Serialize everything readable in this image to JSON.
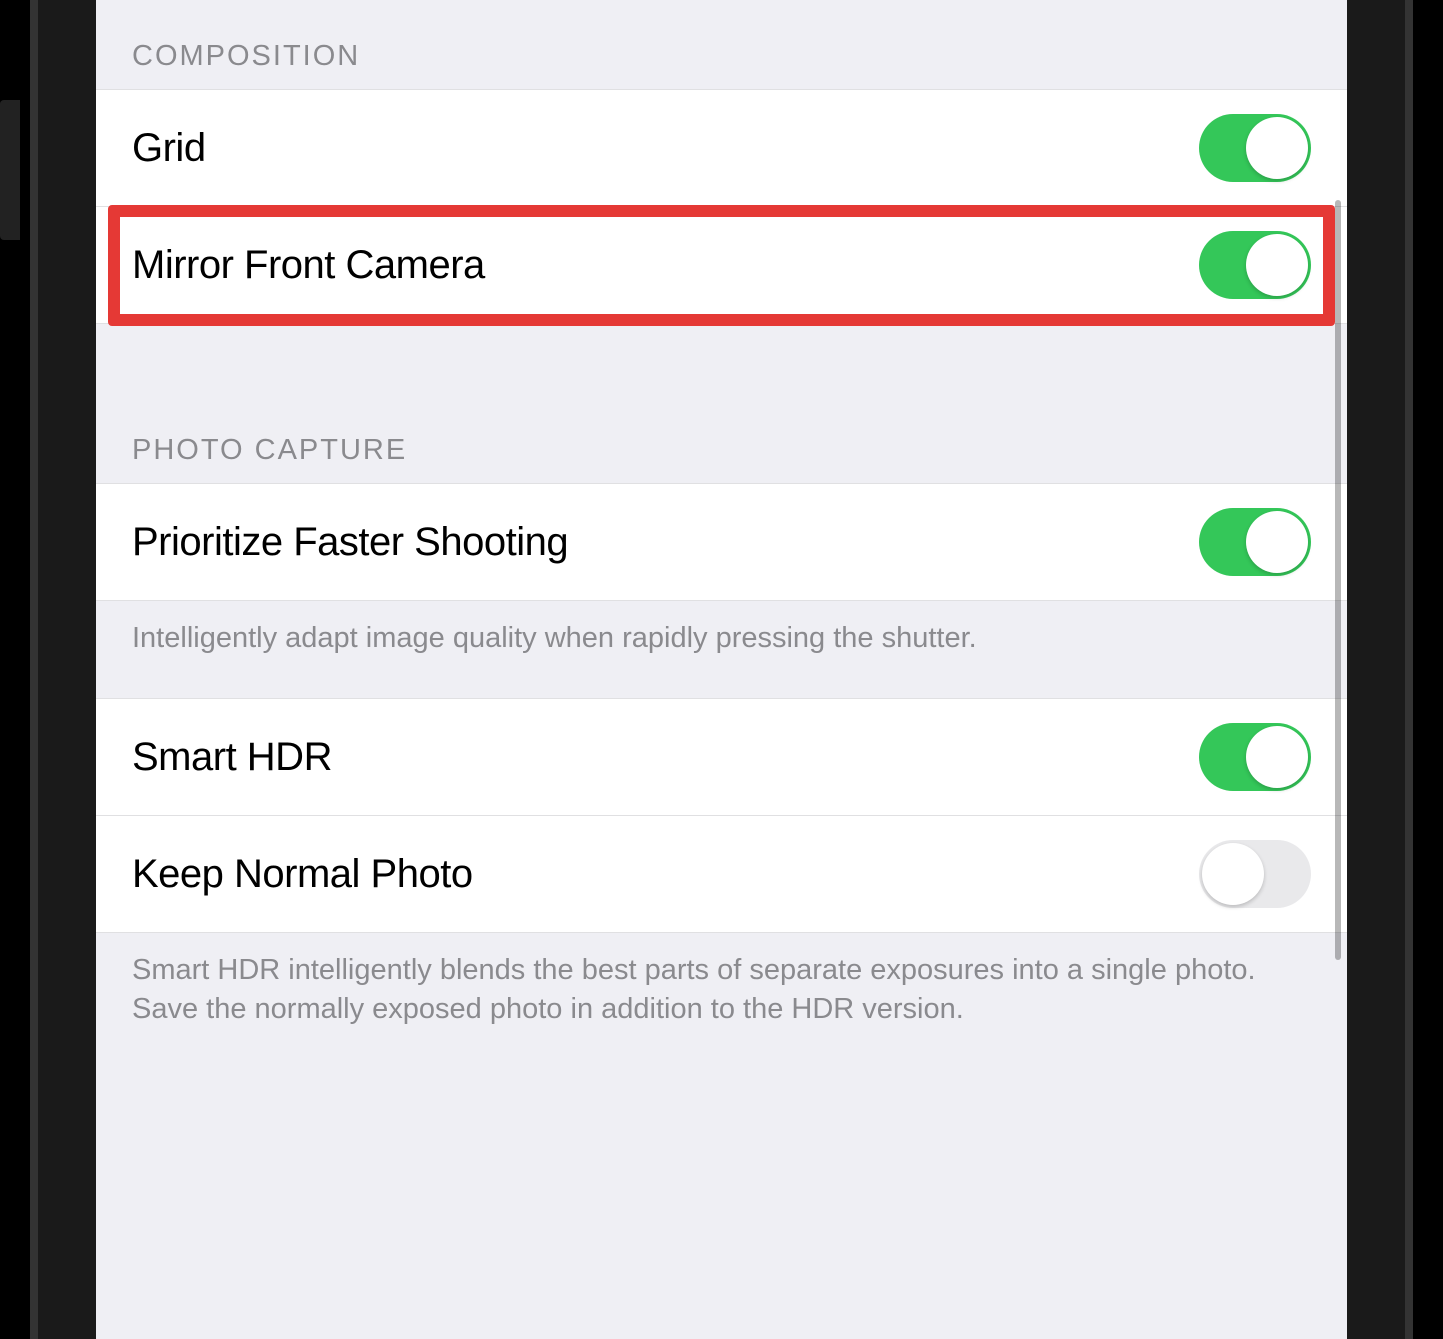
{
  "sections": {
    "composition": {
      "header": "COMPOSITION",
      "rows": {
        "grid": {
          "label": "Grid",
          "on": true
        },
        "mirror": {
          "label": "Mirror Front Camera",
          "on": true
        }
      }
    },
    "photo_capture": {
      "header": "PHOTO CAPTURE",
      "rows": {
        "prioritize": {
          "label": "Prioritize Faster Shooting",
          "on": true
        },
        "smart_hdr": {
          "label": "Smart HDR",
          "on": true
        },
        "keep_normal": {
          "label": "Keep Normal Photo",
          "on": false
        }
      },
      "footers": {
        "prioritize": "Intelligently adapt image quality when rapidly pressing the shutter.",
        "hdr": "Smart HDR intelligently blends the best parts of separate exposures into a single photo. Save the normally exposed photo in addition to the HDR version."
      }
    }
  },
  "highlight": {
    "target": "mirror-front-camera-row"
  }
}
